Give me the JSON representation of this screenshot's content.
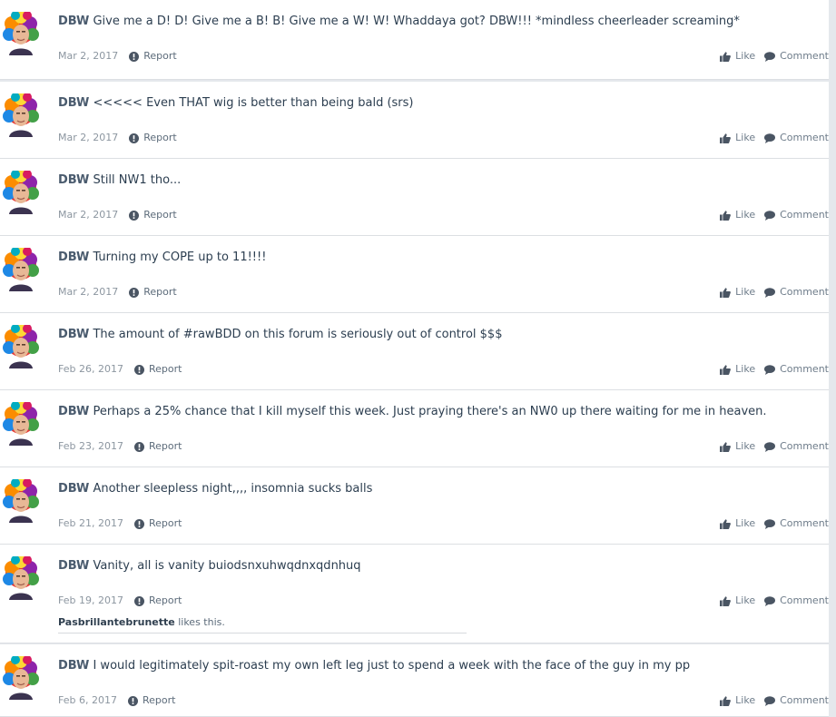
{
  "feed": {
    "report_label": "Report",
    "like_label": "Like",
    "comment_label": "Comment",
    "icons": {
      "avatar": "rainbow-afro-avatar-icon",
      "report": "report-icon",
      "like": "thumbs-up-icon",
      "comment": "comment-bubble-icon"
    },
    "posts": [
      {
        "author": "DBW",
        "text": "Give me a D! D! Give me a B! B! Give me a W! W! Whaddaya got? DBW!!! *mindless cheerleader screaming*",
        "date": "Mar 2, 2017"
      },
      {
        "author": "DBW",
        "text": "<<<<< Even THAT wig is better than being bald (srs)",
        "date": "Mar 2, 2017"
      },
      {
        "author": "DBW",
        "text": "Still NW1 tho...",
        "date": "Mar 2, 2017"
      },
      {
        "author": "DBW",
        "text": "Turning my COPE up to 11!!!!",
        "date": "Mar 2, 2017"
      },
      {
        "author": "DBW",
        "text": "The amount of #rawBDD on this forum is seriously out of control $$$",
        "date": "Feb 26, 2017"
      },
      {
        "author": "DBW",
        "text": "Perhaps a 25% chance that I kill myself this week. Just praying there's an NW0 up there waiting for me in heaven.",
        "date": "Feb 23, 2017"
      },
      {
        "author": "DBW",
        "text": "Another sleepless night,,,, insomnia sucks balls",
        "date": "Feb 21, 2017"
      },
      {
        "author": "DBW",
        "text": "Vanity, all is vanity buiodsnxuhwqdnxqdnhuq",
        "date": "Feb 19, 2017",
        "liked_by": "Pasbrillantebrunette",
        "likes_suffix": "likes this."
      },
      {
        "author": "DBW",
        "text": "I would legitimately spit-roast my own left leg just to spend a week with the face of the guy in my pp",
        "date": "Feb 6, 2017"
      }
    ]
  }
}
